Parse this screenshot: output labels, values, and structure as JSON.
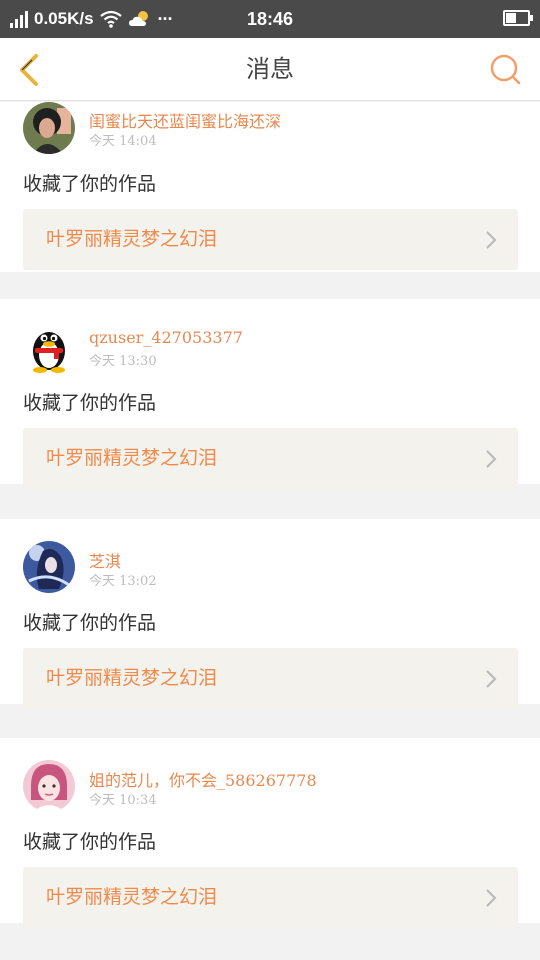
{
  "status_bar": {
    "network_speed": "0.05K/s",
    "more": "···",
    "time": "18:46"
  },
  "header": {
    "title": "消息"
  },
  "messages": [
    {
      "username": "闺蜜比天还蓝闺蜜比海还深",
      "time": "今天 14:04",
      "action": "收藏了你的作品",
      "work_title": "叶罗丽精灵梦之幻泪"
    },
    {
      "username": "qzuser_427053377",
      "time": "今天 13:30",
      "action": "收藏了你的作品",
      "work_title": "叶罗丽精灵梦之幻泪"
    },
    {
      "username": "芝淇",
      "time": "今天 13:02",
      "action": "收藏了你的作品",
      "work_title": "叶罗丽精灵梦之幻泪"
    },
    {
      "username": "姐的范儿，你不会_586267778",
      "time": "今天 10:34",
      "action": "收藏了你的作品",
      "work_title": "叶罗丽精灵梦之幻泪"
    }
  ],
  "colors": {
    "accent": "#f08a4b",
    "status_bar": "#4a4a4a",
    "card_bg": "#f3f2ec"
  }
}
